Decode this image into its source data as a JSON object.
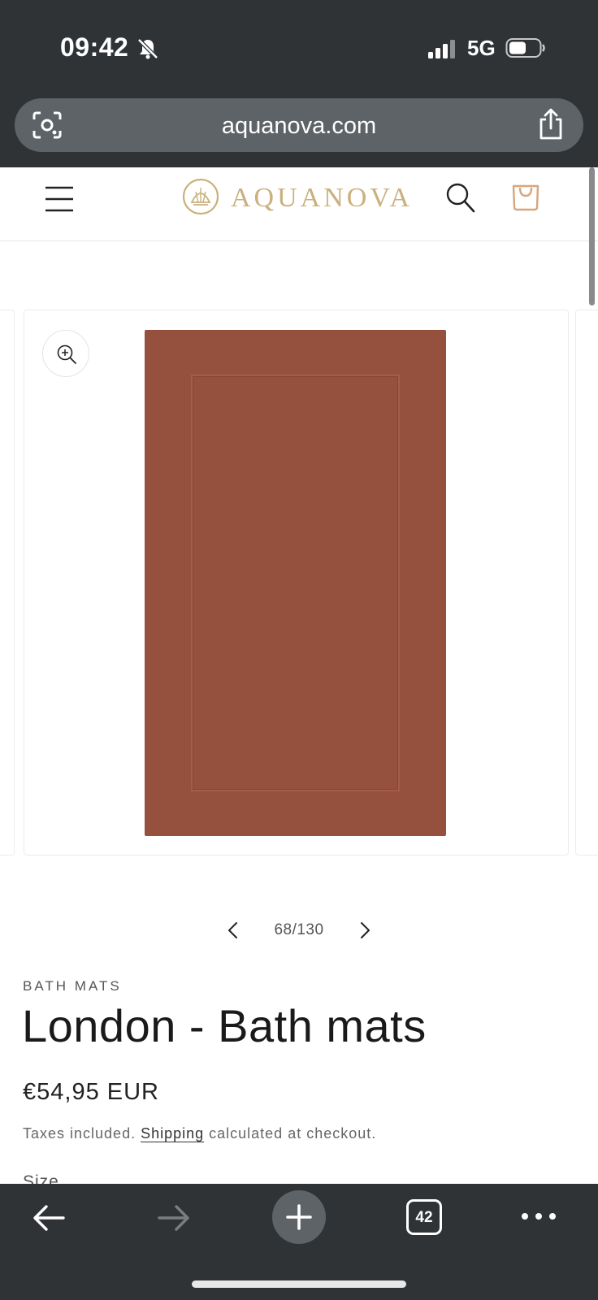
{
  "status_bar": {
    "time": "09:42",
    "network": "5G",
    "icons": [
      "bell-slash-icon",
      "signal-icon",
      "battery-icon"
    ]
  },
  "browser": {
    "url": "aquanova.com",
    "tabs_count": "42",
    "icons": [
      "camera-lens-icon",
      "share-icon",
      "back-arrow-icon",
      "forward-arrow-icon",
      "plus-icon",
      "tabs-icon",
      "more-icon"
    ]
  },
  "header": {
    "brand": "AQUANOVA",
    "icons": [
      "hamburger-menu-icon",
      "shell-logo-icon",
      "search-icon",
      "shopping-bag-icon"
    ]
  },
  "gallery": {
    "counter": "68/130",
    "image_color": "#95503e"
  },
  "product": {
    "category": "BATH MATS",
    "title": "London - Bath mats",
    "price": "€54,95 EUR",
    "tax_prefix": "Taxes included. ",
    "shipping_link": "Shipping",
    "tax_suffix": " calculated at checkout.",
    "size_label": "Size"
  },
  "colors": {
    "chrome": "#303336",
    "brand_gold": "#c9b07c",
    "cart_accent": "#d8a57a"
  }
}
